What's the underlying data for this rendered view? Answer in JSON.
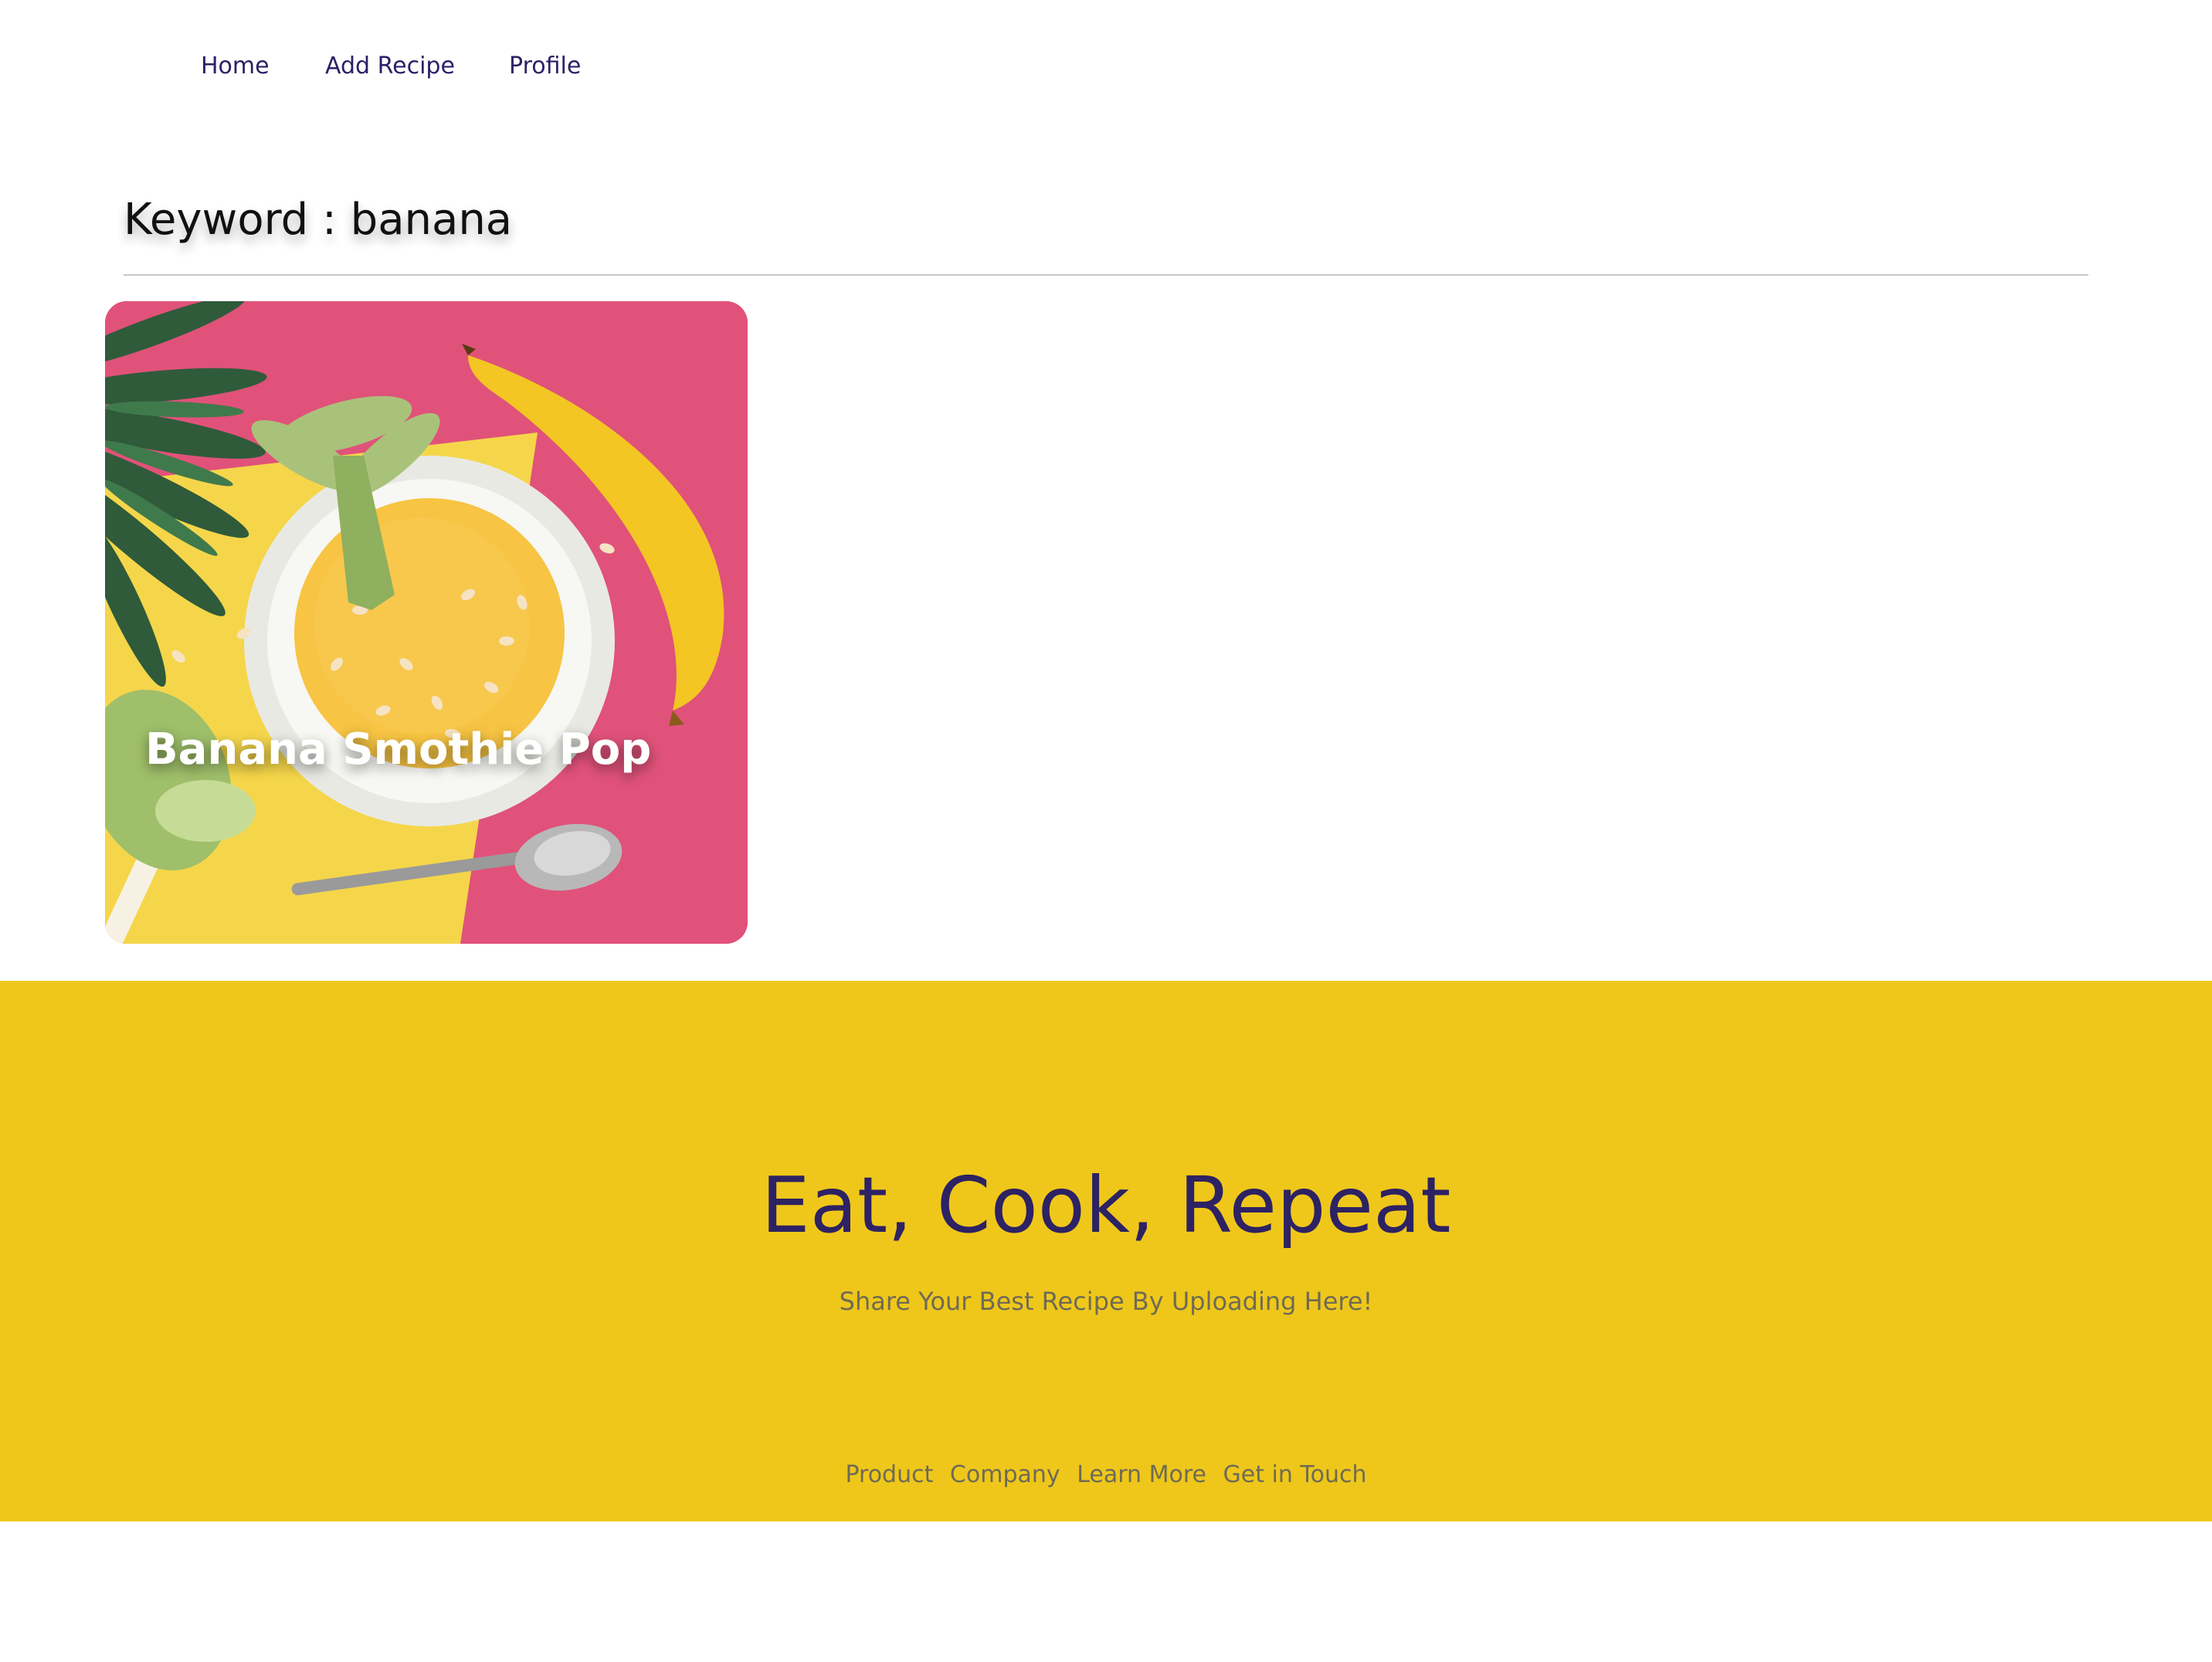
{
  "nav": {
    "items": [
      {
        "label": "Home"
      },
      {
        "label": "Add Recipe"
      },
      {
        "label": "Profile"
      }
    ]
  },
  "search": {
    "heading": "Keyword : banana"
  },
  "results": [
    {
      "title": "Banana Smothie Pop",
      "image": "bowl-of-banana-smoothie-with-banana-and-palm-leaves"
    }
  ],
  "footer": {
    "title": "Eat, Cook, Repeat",
    "subtitle": "Share Your Best Recipe By Uploading Here!",
    "links": [
      "Product",
      "Company",
      "Learn More",
      "Get in Touch"
    ]
  },
  "colors": {
    "nav_text": "#2a2266",
    "footer_bg": "#efc71a",
    "footer_title": "#2d2263",
    "footer_text": "#6e6b55",
    "card_pink": "#e0527a",
    "card_yellow": "#f5d64a"
  }
}
